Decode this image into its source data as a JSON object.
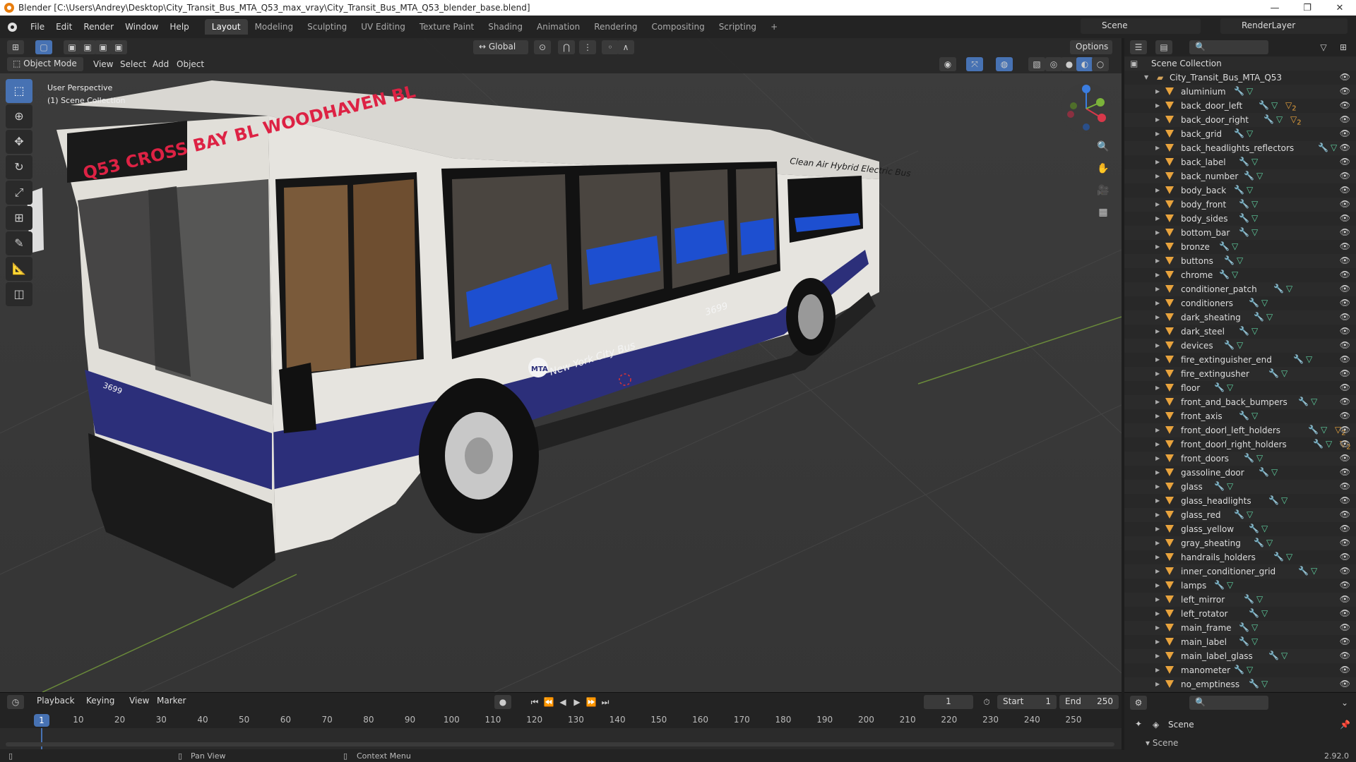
{
  "window": {
    "title": "Blender [C:\\Users\\Andrey\\Desktop\\City_Transit_Bus_MTA_Q53_max_vray\\City_Transit_Bus_MTA_Q53_blender_base.blend]",
    "minimize": "—",
    "maximize": "❐",
    "close": "✕"
  },
  "menu": [
    "File",
    "Edit",
    "Render",
    "Window",
    "Help"
  ],
  "workspaces": [
    "Layout",
    "Modeling",
    "Sculpting",
    "UV Editing",
    "Texture Paint",
    "Shading",
    "Animation",
    "Rendering",
    "Compositing",
    "Scripting",
    "+"
  ],
  "active_workspace": "Layout",
  "scene_name": "Scene",
  "render_layer": "RenderLayer",
  "viewport": {
    "mode": "Object Mode",
    "menus": [
      "View",
      "Select",
      "Add",
      "Object"
    ],
    "orientation": "Global",
    "options": "Options",
    "perspective": "User Perspective",
    "collection": "(1) Scene Collection"
  },
  "bus": {
    "destination_sign": "Q53 CROSS BAY BL WOODHAVEN BL",
    "fleet_number": "3699",
    "side_text": "New York City Bus",
    "roof_text": "Clean Air Hybrid Electric Bus",
    "logo": "MTA",
    "colors": {
      "body": "#e8e6e0",
      "stripe": "#2c2f7a",
      "seats": "#1d4fd0"
    }
  },
  "timeline": {
    "menus": [
      "Playback",
      "Keying",
      "View",
      "Marker"
    ],
    "current_frame": "1",
    "start_label": "Start",
    "start": "1",
    "end_label": "End",
    "end": "250",
    "ticks": [
      "1",
      "10",
      "20",
      "30",
      "40",
      "50",
      "60",
      "70",
      "80",
      "90",
      "100",
      "110",
      "120",
      "130",
      "140",
      "150",
      "160",
      "170",
      "180",
      "190",
      "200",
      "210",
      "220",
      "230",
      "240",
      "250"
    ]
  },
  "status": {
    "pan": "Pan View",
    "context": "Context Menu",
    "version": "2.92.0"
  },
  "outliner": {
    "root": "Scene Collection",
    "collection": "City_Transit_Bus_MTA_Q53",
    "items": [
      {
        "name": "aluminium",
        "mat": ""
      },
      {
        "name": "back_door_left",
        "mat": "2"
      },
      {
        "name": "back_door_right",
        "mat": "2"
      },
      {
        "name": "back_grid",
        "mat": ""
      },
      {
        "name": "back_headlights_reflectors",
        "mat": ""
      },
      {
        "name": "back_label",
        "mat": ""
      },
      {
        "name": "back_number",
        "mat": ""
      },
      {
        "name": "body_back",
        "mat": ""
      },
      {
        "name": "body_front",
        "mat": ""
      },
      {
        "name": "body_sides",
        "mat": ""
      },
      {
        "name": "bottom_bar",
        "mat": ""
      },
      {
        "name": "bronze",
        "mat": ""
      },
      {
        "name": "buttons",
        "mat": ""
      },
      {
        "name": "chrome",
        "mat": ""
      },
      {
        "name": "conditioner_patch",
        "mat": ""
      },
      {
        "name": "conditioners",
        "mat": ""
      },
      {
        "name": "dark_sheating",
        "mat": ""
      },
      {
        "name": "dark_steel",
        "mat": ""
      },
      {
        "name": "devices",
        "mat": ""
      },
      {
        "name": "fire_extinguisher_end",
        "mat": ""
      },
      {
        "name": "fire_extingusher",
        "mat": ""
      },
      {
        "name": "floor",
        "mat": ""
      },
      {
        "name": "front_and_back_bumpers",
        "mat": ""
      },
      {
        "name": "front_axis",
        "mat": ""
      },
      {
        "name": "front_doorl_left_holders",
        "mat": "2"
      },
      {
        "name": "front_doorl_right_holders",
        "mat": "2"
      },
      {
        "name": "front_doors",
        "mat": ""
      },
      {
        "name": "gassoline_door",
        "mat": ""
      },
      {
        "name": "glass",
        "mat": ""
      },
      {
        "name": "glass_headlights",
        "mat": ""
      },
      {
        "name": "glass_red",
        "mat": ""
      },
      {
        "name": "glass_yellow",
        "mat": ""
      },
      {
        "name": "gray_sheating",
        "mat": ""
      },
      {
        "name": "handrails_holders",
        "mat": ""
      },
      {
        "name": "inner_conditioner_grid",
        "mat": ""
      },
      {
        "name": "lamps",
        "mat": ""
      },
      {
        "name": "left_mirror",
        "mat": ""
      },
      {
        "name": "left_rotator",
        "mat": ""
      },
      {
        "name": "main_frame",
        "mat": ""
      },
      {
        "name": "main_label",
        "mat": ""
      },
      {
        "name": "main_label_glass",
        "mat": ""
      },
      {
        "name": "manometer",
        "mat": ""
      },
      {
        "name": "no_emptiness",
        "mat": ""
      }
    ]
  },
  "properties": {
    "scene_label": "Scene",
    "scene_section": "Scene"
  }
}
